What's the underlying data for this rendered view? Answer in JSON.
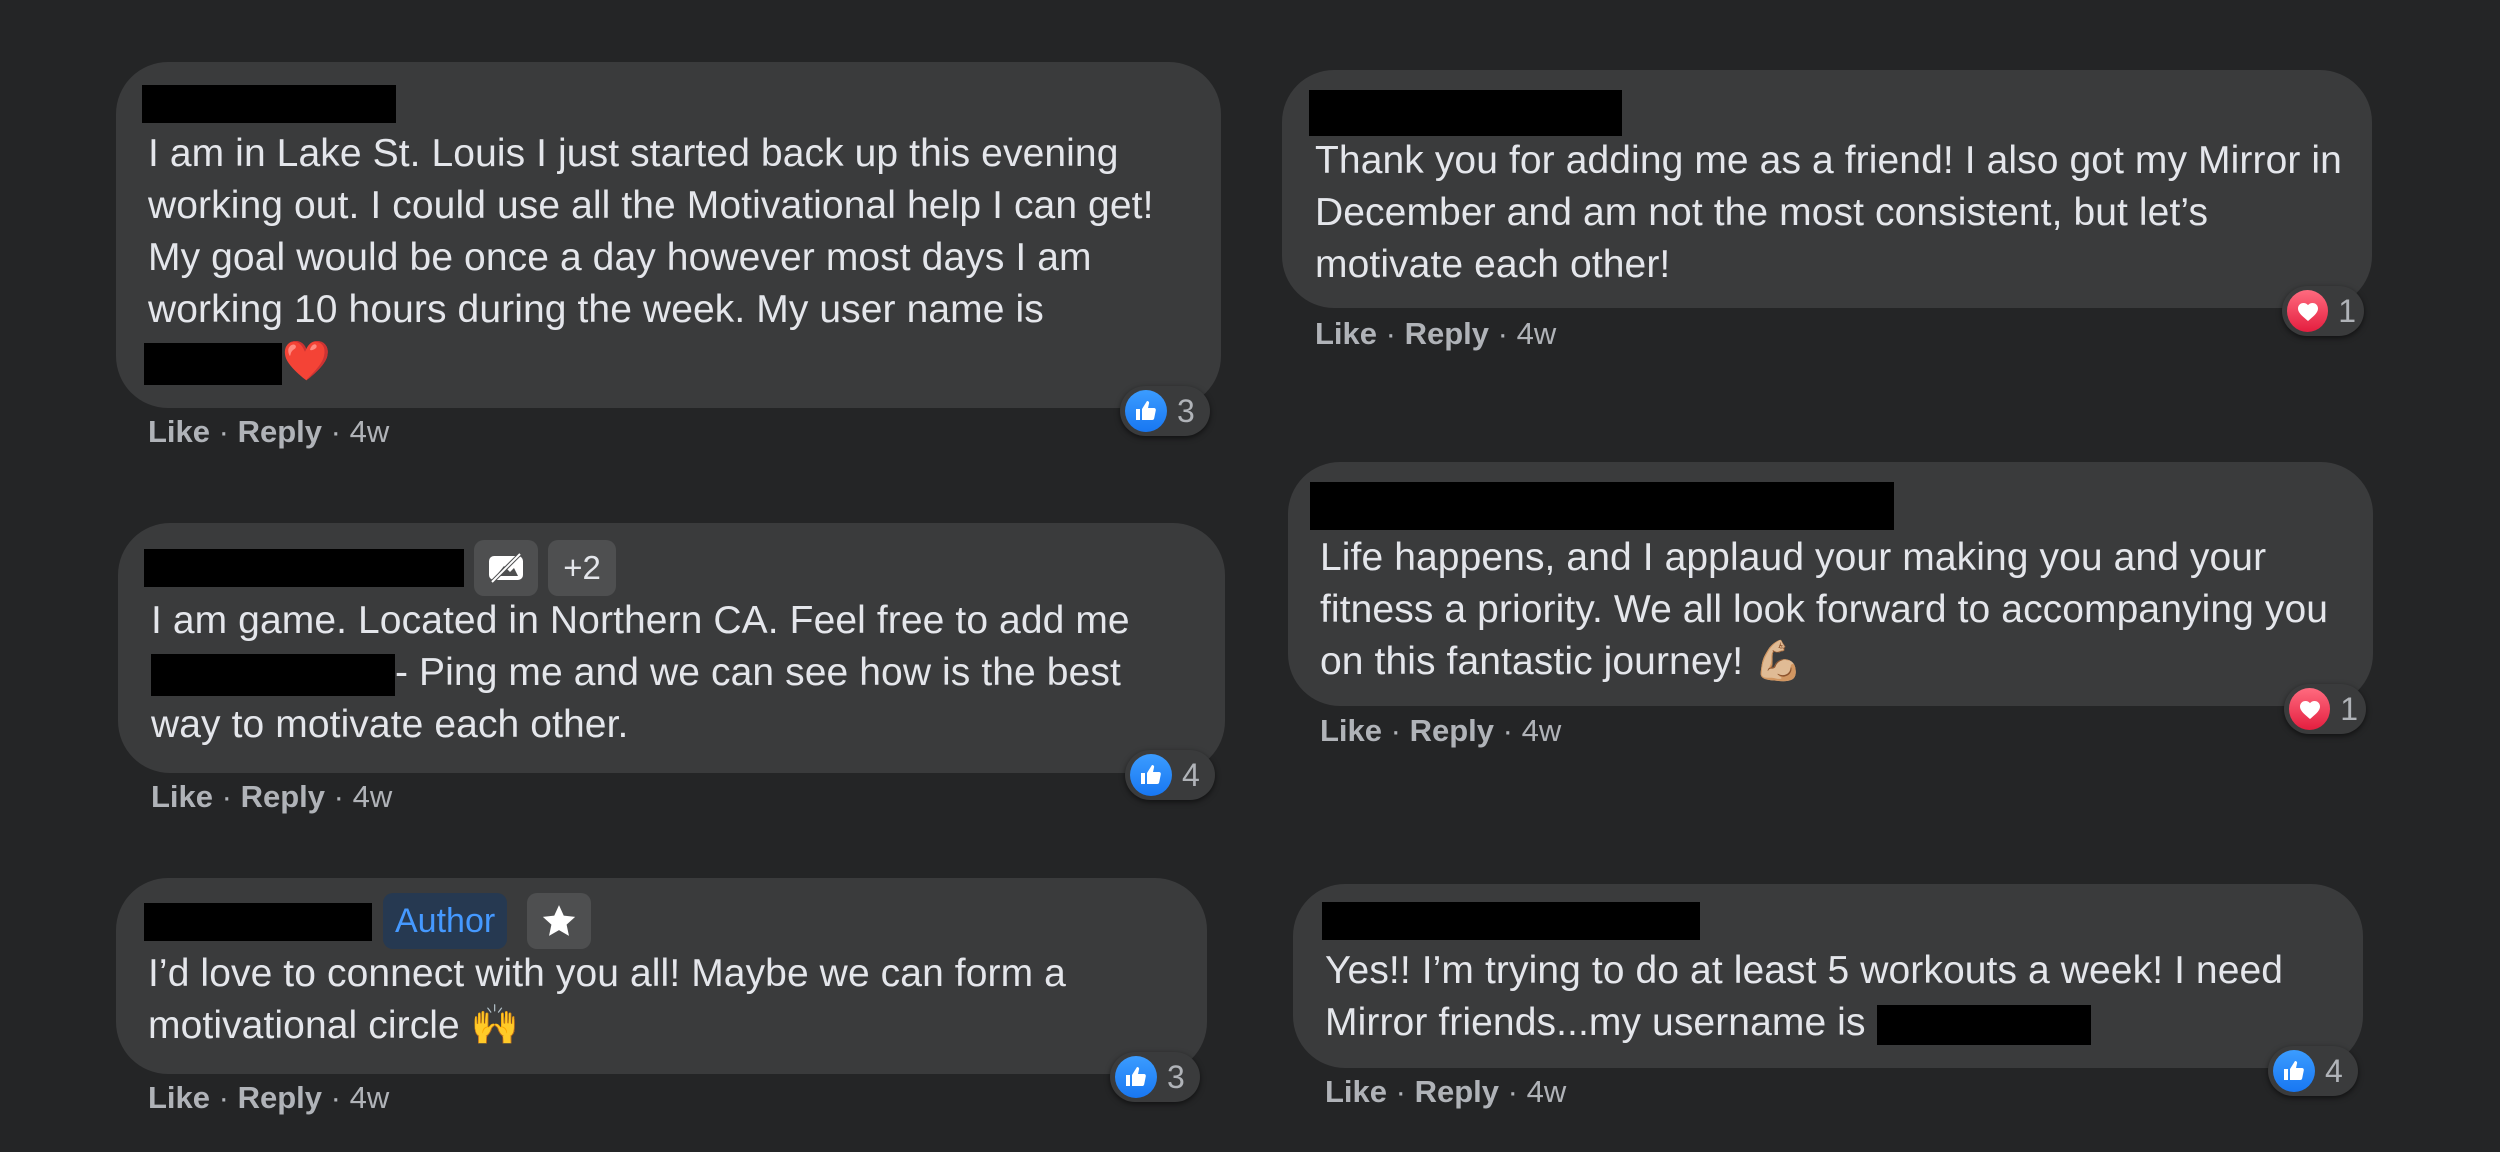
{
  "colors": {
    "background": "#242526",
    "bubble": "#3a3b3c",
    "text": "#e4e6eb",
    "meta": "#b0b3b8",
    "like_blue": "#1877f2",
    "love_red": "#e41e3f",
    "author_blue": "#4599ff"
  },
  "actions": {
    "like": "Like",
    "reply": "Reply",
    "sep": "·"
  },
  "comments": [
    {
      "text_line1": "I am in Lake St. Louis I just started back up this evening working out. I could use all the Motivational help I can get! My goal would be once a day however most days I am working 10 hours during the week. My user name is",
      "trailing_emoji": "❤️",
      "time": "4w",
      "reaction_icon": "like-icon",
      "reaction_count": "3"
    },
    {
      "badge_icon": "no-video-icon",
      "badge_plus": "+2",
      "text_a": "I am game. Located in Northern CA. Feel free to add me",
      "text_b": "- Ping me and we can see how is the best way to motivate each other.",
      "time": "4w",
      "reaction_icon": "like-icon",
      "reaction_count": "4"
    },
    {
      "badge_author": "Author",
      "badge_icon": "star-icon",
      "text": "I’d love to connect with you all! Maybe we can form a motivational circle 🙌",
      "time": "4w",
      "reaction_icon": "like-icon",
      "reaction_count": "3"
    },
    {
      "text": "Thank you for adding me as a friend! I also got my Mirror in December and am not the most consistent, but let’s motivate each other!",
      "time": "4w",
      "reaction_icon": "heart-icon",
      "reaction_count": "1"
    },
    {
      "text": "Life happens, and I applaud your making you and your fitness a priority. We all look forward to accompanying you on this fantastic journey! 💪🏼",
      "time": "4w",
      "reaction_icon": "heart-icon",
      "reaction_count": "1"
    },
    {
      "text": "Yes!! I’m trying to do at least 5 workouts a week! I need Mirror friends...my username is",
      "time": "4w",
      "reaction_icon": "like-icon",
      "reaction_count": "4"
    }
  ]
}
